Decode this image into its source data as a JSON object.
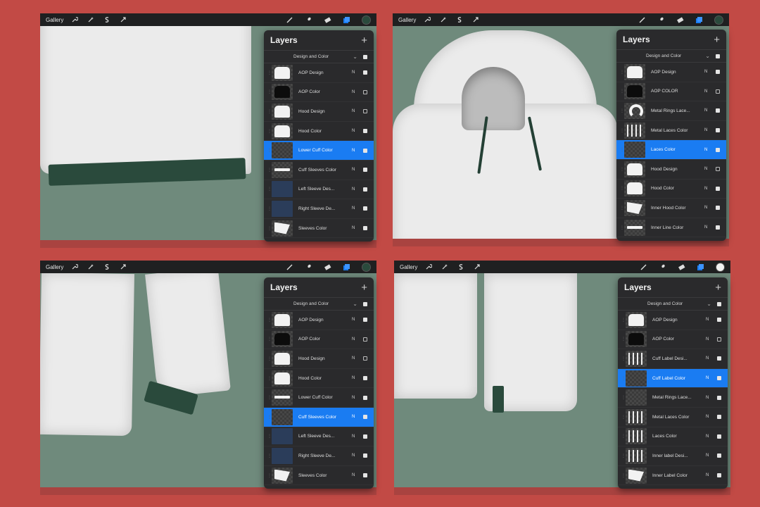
{
  "colors": {
    "background": "#c24a45",
    "canvas": "#6f8a7c",
    "toolbar": "#1f2021",
    "panel": "#2a2a2c",
    "selected": "#1a7cf2",
    "accent_green": "#2a4a3c"
  },
  "toolbar": {
    "gallery_label": "Gallery",
    "left_icons": [
      "wrench-icon",
      "magic-wand-icon",
      "selection-icon",
      "transform-arrow-icon"
    ],
    "right_icons": [
      "brush-icon",
      "smudge-icon",
      "eraser-icon",
      "layers-icon",
      "color-swatch"
    ]
  },
  "screens": [
    {
      "panel": {
        "title": "Layers",
        "group": "Design and Color",
        "layers": [
          {
            "name": "AOP  Design",
            "mode": "N",
            "visible": true,
            "selected": false,
            "thumb": "white"
          },
          {
            "name": "AOP Color",
            "mode": "N",
            "visible": false,
            "selected": false,
            "thumb": "dark"
          },
          {
            "name": "Hood Design",
            "mode": "N",
            "visible": false,
            "selected": false,
            "thumb": "white"
          },
          {
            "name": "Hood Color",
            "mode": "N",
            "visible": true,
            "selected": false,
            "thumb": "white"
          },
          {
            "name": "Lower Cuff Color",
            "mode": "N",
            "visible": true,
            "selected": true,
            "thumb": "empty"
          },
          {
            "name": "Cuff Sleeves Color",
            "mode": "N",
            "visible": true,
            "selected": false,
            "thumb": "strip"
          },
          {
            "name": "Left Sleeve Des...",
            "mode": "N",
            "visible": true,
            "selected": false,
            "thumb": "navy"
          },
          {
            "name": "Right Sleeve De...",
            "mode": "N",
            "visible": true,
            "selected": false,
            "thumb": "navy"
          },
          {
            "name": "Sleeves Color",
            "mode": "N",
            "visible": true,
            "selected": false,
            "thumb": "tri"
          }
        ]
      }
    },
    {
      "panel": {
        "title": "Layers",
        "group": "Design and Color",
        "layers": [
          {
            "name": "AOP  Design",
            "mode": "N",
            "visible": true,
            "selected": false,
            "thumb": "white"
          },
          {
            "name": "AOP COLOR",
            "mode": "N",
            "visible": false,
            "selected": false,
            "thumb": "dark"
          },
          {
            "name": "Metal Rings Lace...",
            "mode": "N",
            "visible": true,
            "selected": false,
            "thumb": "ring"
          },
          {
            "name": "Metal Laces Color",
            "mode": "N",
            "visible": true,
            "selected": false,
            "thumb": "lines"
          },
          {
            "name": "Laces Color",
            "mode": "N",
            "visible": true,
            "selected": true,
            "thumb": "empty"
          },
          {
            "name": "Hood Design",
            "mode": "N",
            "visible": false,
            "selected": false,
            "thumb": "white"
          },
          {
            "name": "Hood Color",
            "mode": "N",
            "visible": true,
            "selected": false,
            "thumb": "white"
          },
          {
            "name": "Inner Hood Color",
            "mode": "N",
            "visible": true,
            "selected": false,
            "thumb": "tri"
          },
          {
            "name": "Inner Line Color",
            "mode": "N",
            "visible": true,
            "selected": false,
            "thumb": "strip"
          }
        ]
      }
    },
    {
      "panel": {
        "title": "Layers",
        "group": "Design and Color",
        "layers": [
          {
            "name": "AOP  Design",
            "mode": "N",
            "visible": true,
            "selected": false,
            "thumb": "white"
          },
          {
            "name": "AOP Color",
            "mode": "N",
            "visible": false,
            "selected": false,
            "thumb": "dark"
          },
          {
            "name": "Hood Design",
            "mode": "N",
            "visible": false,
            "selected": false,
            "thumb": "white"
          },
          {
            "name": "Hood Color",
            "mode": "N",
            "visible": true,
            "selected": false,
            "thumb": "white"
          },
          {
            "name": "Lower Cuff Color",
            "mode": "N",
            "visible": true,
            "selected": false,
            "thumb": "strip"
          },
          {
            "name": "Cuff Sleeves Color",
            "mode": "N",
            "visible": true,
            "selected": true,
            "thumb": "empty"
          },
          {
            "name": "Left Sleeve Des...",
            "mode": "N",
            "visible": true,
            "selected": false,
            "thumb": "navy"
          },
          {
            "name": "Right Sleeve De...",
            "mode": "N",
            "visible": true,
            "selected": false,
            "thumb": "navy"
          },
          {
            "name": "Sleeves Color",
            "mode": "N",
            "visible": true,
            "selected": false,
            "thumb": "tri"
          }
        ]
      }
    },
    {
      "panel": {
        "title": "Layers",
        "group": "Design and Color",
        "layers": [
          {
            "name": "AOP  Design",
            "mode": "N",
            "visible": true,
            "selected": false,
            "thumb": "white"
          },
          {
            "name": "AOP Color",
            "mode": "N",
            "visible": false,
            "selected": false,
            "thumb": "dark"
          },
          {
            "name": "Cuff Label Desi...",
            "mode": "N",
            "visible": true,
            "selected": false,
            "thumb": "lines"
          },
          {
            "name": "Cuff  Label Color",
            "mode": "N",
            "visible": true,
            "selected": true,
            "thumb": "empty"
          },
          {
            "name": "Metal Rings Lace...",
            "mode": "N",
            "visible": true,
            "selected": false,
            "thumb": "empty"
          },
          {
            "name": "Metal Laces Color",
            "mode": "N",
            "visible": true,
            "selected": false,
            "thumb": "lines"
          },
          {
            "name": "Laces Color",
            "mode": "N",
            "visible": true,
            "selected": false,
            "thumb": "lines"
          },
          {
            "name": "Inner label Desi...",
            "mode": "N",
            "visible": true,
            "selected": false,
            "thumb": "lines"
          },
          {
            "name": "Inner Label Color",
            "mode": "N",
            "visible": true,
            "selected": false,
            "thumb": "tri"
          }
        ]
      }
    }
  ]
}
